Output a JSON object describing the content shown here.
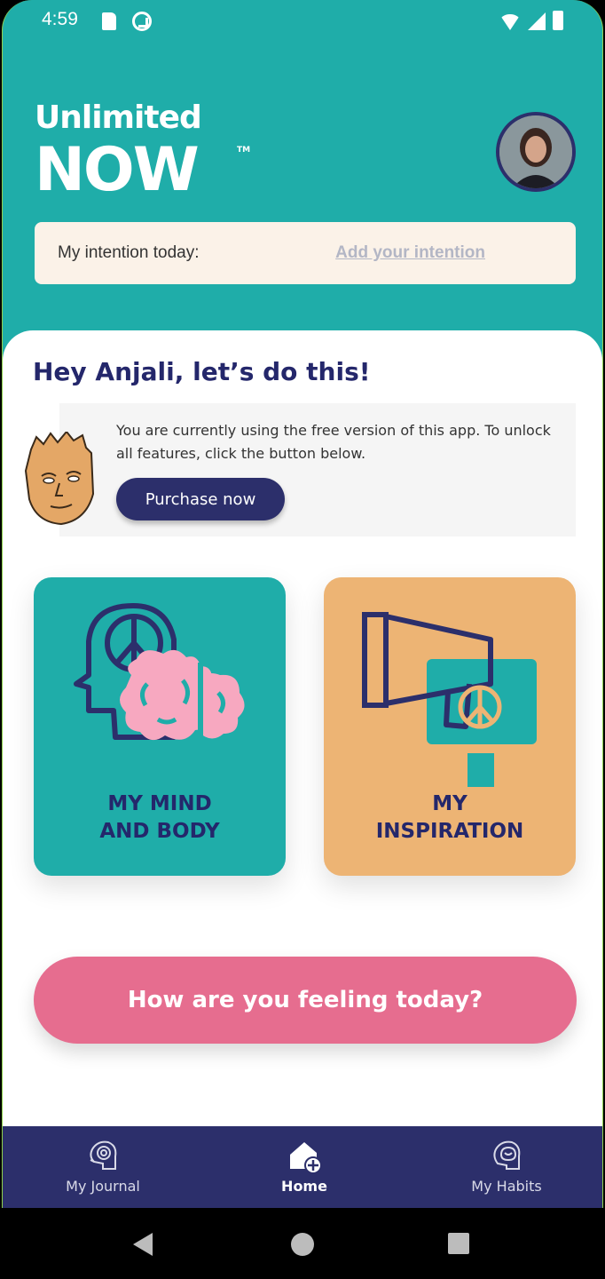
{
  "status_bar": {
    "time": "4:59"
  },
  "header": {
    "logo_top": "Unlimited",
    "logo_main": "NOW",
    "logo_tm": "TM"
  },
  "intention": {
    "label": "My intention today:",
    "link": "Add your intention"
  },
  "main": {
    "greeting": "Hey Anjali, let’s do this!",
    "promo_text": "You are currently using the free version of this app. To unlock all features, click the button below.",
    "purchase_label": "Purchase now",
    "cards": [
      {
        "title_line1": "MY MIND",
        "title_line2": "AND BODY",
        "color": "#1fada9",
        "icon": "head-brain-peace-icon"
      },
      {
        "title_line1": "MY",
        "title_line2": "INSPIRATION",
        "color": "#edb474",
        "icon": "megaphone-peace-icon"
      }
    ],
    "feeling_label": "How are you feeling today?"
  },
  "bottom_nav": {
    "items": [
      {
        "label": "My Journal",
        "icon": "journal-head-icon",
        "active": false
      },
      {
        "label": "Home",
        "icon": "home-add-icon",
        "active": true
      },
      {
        "label": "My Habits",
        "icon": "habits-head-icon",
        "active": false
      }
    ]
  },
  "colors": {
    "teal": "#1fada9",
    "navy": "#2c2f6b",
    "pink": "#e66d8f",
    "orange": "#edb474",
    "cream": "#fbf2e8"
  }
}
